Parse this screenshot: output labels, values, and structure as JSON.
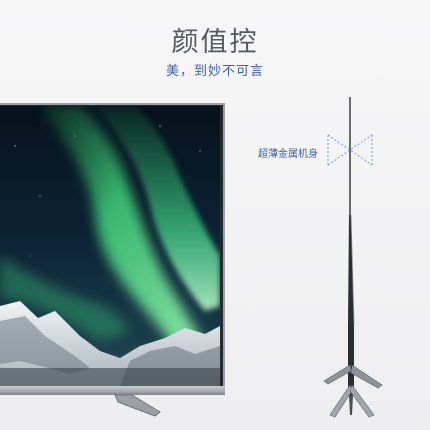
{
  "header": {
    "title": "颜值控",
    "subtitle": "美，到妙不可言"
  },
  "annotation": {
    "label": "超薄金属机身"
  },
  "colors": {
    "accent_blue": "#3c5fb0",
    "title_gray": "#555a60",
    "aurora_green": "#3fd27a",
    "sky_dark": "#0b1a2a"
  },
  "icons": {
    "thickness": "double-arrow-bracket-icon"
  }
}
